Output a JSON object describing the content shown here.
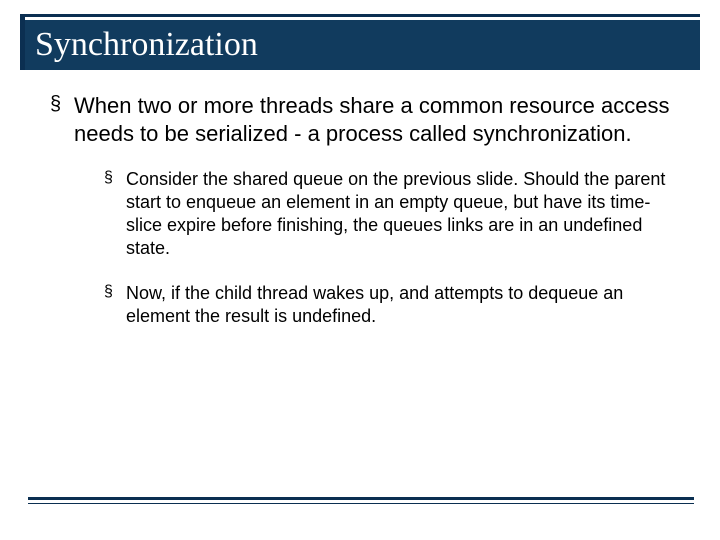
{
  "slide": {
    "title": "Synchronization",
    "bullets": [
      {
        "text": "When two or more threads share a common resource access needs to be serialized - a process called synchronization.",
        "children": [
          {
            "text": "Consider the shared queue on the previous slide.  Should the parent start to enqueue an element in an empty queue, but have its time-slice expire before finishing, the queues links are in an undefined state."
          },
          {
            "text": "Now, if the child thread wakes up, and attempts to dequeue an element the result is undefined."
          }
        ]
      }
    ]
  }
}
